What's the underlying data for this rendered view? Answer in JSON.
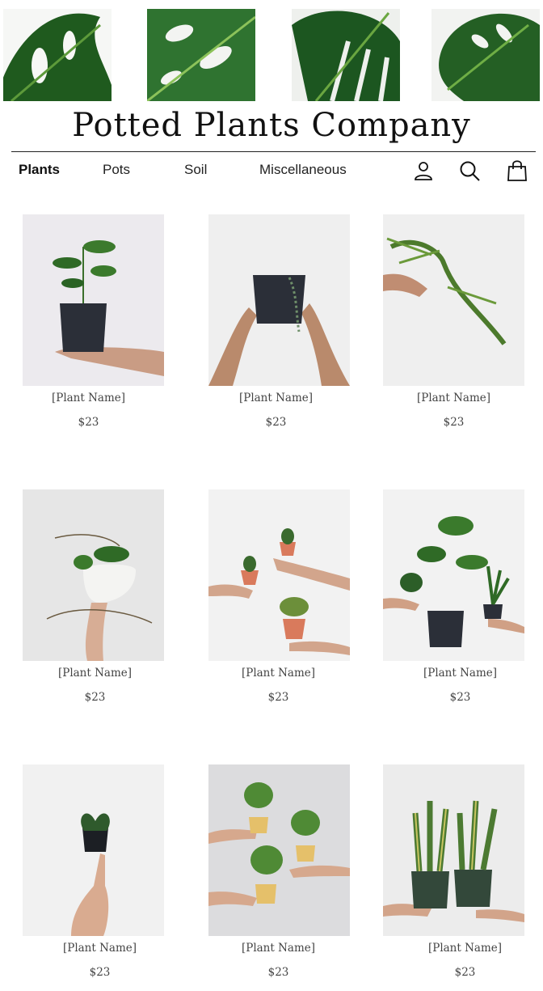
{
  "brand": {
    "name": "Potted Plants Company"
  },
  "nav": {
    "items": [
      {
        "label": "Plants",
        "active": true
      },
      {
        "label": "Pots",
        "active": false
      },
      {
        "label": "Soil",
        "active": false
      },
      {
        "label": "Miscellaneous",
        "active": false
      }
    ]
  },
  "header_icons": [
    "user-icon",
    "search-icon",
    "shopping-bag-icon"
  ],
  "colors": {
    "text": "#111111",
    "muted": "#444444",
    "pot_dark": "#2b2f38",
    "leaf": "#2e6b2a"
  },
  "products": [
    {
      "name": "[Plant Name]",
      "price": "$23"
    },
    {
      "name": "[Plant Name]",
      "price": "$23"
    },
    {
      "name": "[Plant Name]",
      "price": "$23"
    },
    {
      "name": "[Plant Name]",
      "price": "$23"
    },
    {
      "name": "[Plant Name]",
      "price": "$23"
    },
    {
      "name": "[Plant Name]",
      "price": "$23"
    },
    {
      "name": "[Plant Name]",
      "price": "$23"
    },
    {
      "name": "[Plant Name]",
      "price": "$23"
    },
    {
      "name": "[Plant Name]",
      "price": "$23"
    }
  ]
}
